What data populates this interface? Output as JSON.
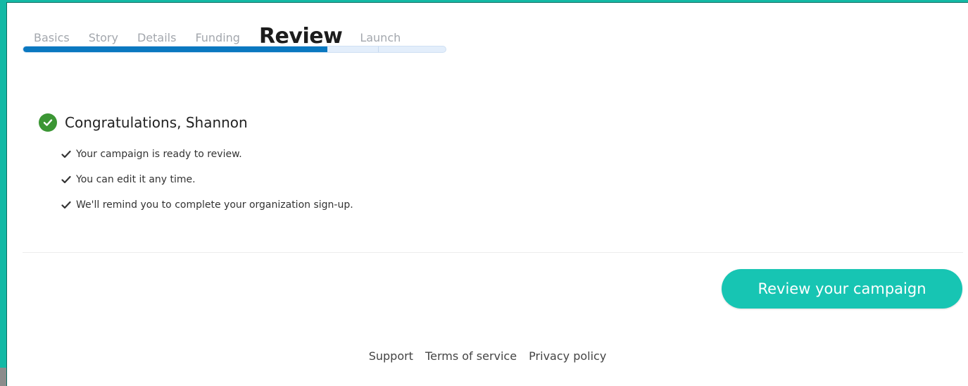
{
  "steps": {
    "items": [
      {
        "label": "Basics"
      },
      {
        "label": "Story"
      },
      {
        "label": "Details"
      },
      {
        "label": "Funding"
      },
      {
        "label": "Review"
      },
      {
        "label": "Launch"
      }
    ],
    "current_index": 4
  },
  "progress": {
    "fraction": 0.72
  },
  "congrats": {
    "title": "Congratulations, Shannon",
    "bullets": [
      "Your campaign is ready to review.",
      "You can edit it any time.",
      "We'll remind you to complete your organization sign-up."
    ]
  },
  "cta": {
    "label": "Review your campaign"
  },
  "footer": {
    "links": [
      "Support",
      "Terms of service",
      "Privacy policy"
    ]
  },
  "colors": {
    "accent": "#17c5b3",
    "progress": "#0a78c0",
    "success": "#3b9634",
    "frame": "#13b9a5"
  },
  "icons": {
    "success": "check-circle-icon",
    "bullet": "checkmark-icon"
  }
}
